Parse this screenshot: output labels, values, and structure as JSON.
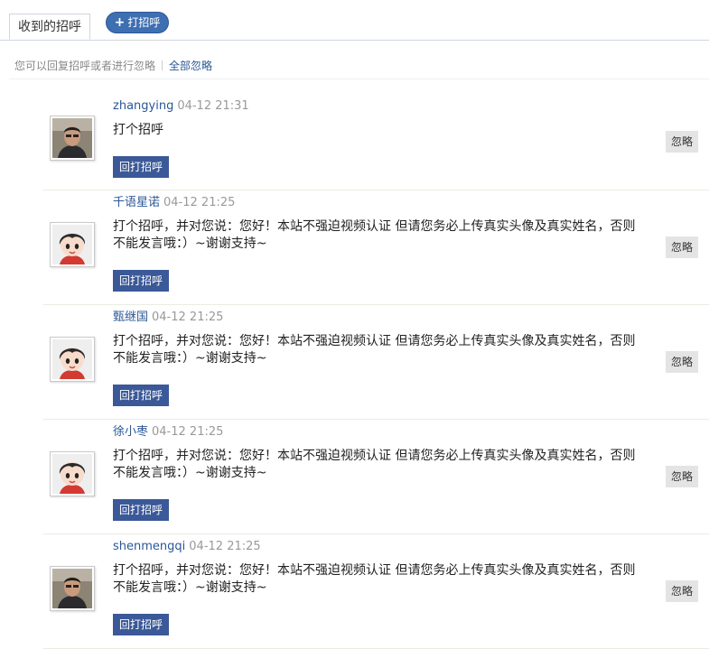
{
  "tabs": {
    "received_label": "收到的招呼"
  },
  "actions": {
    "greet_label": "打招呼",
    "greet_icon": "plus-icon"
  },
  "hint": {
    "text": "您可以回复招呼或者进行忽略",
    "ignore_all": "全部忽略"
  },
  "items": [
    {
      "name": "zhangying",
      "time": "04-12 21:31",
      "message": "打个招呼",
      "reply_label": "回打招呼",
      "ignore_label": "忽略",
      "avatar": "photo"
    },
    {
      "name": "千语星诺",
      "time": "04-12 21:25",
      "message": "打个招呼，并对您说：您好！本站不强迫视频认证 但请您务必上传真实头像及真实姓名，否则不能发言哦：）~谢谢支持~",
      "reply_label": "回打招呼",
      "ignore_label": "忽略",
      "avatar": "default"
    },
    {
      "name": "甄继国",
      "time": "04-12 21:25",
      "message": "打个招呼，并对您说：您好！本站不强迫视频认证 但请您务必上传真实头像及真实姓名，否则不能发言哦：）~谢谢支持~",
      "reply_label": "回打招呼",
      "ignore_label": "忽略",
      "avatar": "default"
    },
    {
      "name": "徐小枣",
      "time": "04-12 21:25",
      "message": "打个招呼，并对您说：您好！本站不强迫视频认证 但请您务必上传真实头像及真实姓名，否则不能发言哦：）~谢谢支持~",
      "reply_label": "回打招呼",
      "ignore_label": "忽略",
      "avatar": "default"
    },
    {
      "name": "shenmengqi",
      "time": "04-12 21:25",
      "message": "打个招呼，并对您说：您好！本站不强迫视频认证 但请您务必上传真实头像及真实姓名，否则不能发言哦：）~谢谢支持~",
      "reply_label": "回打招呼",
      "ignore_label": "忽略",
      "avatar": "photo"
    }
  ],
  "colors": {
    "accent": "#3b5998",
    "link": "#2b5797",
    "time": "#999999"
  }
}
